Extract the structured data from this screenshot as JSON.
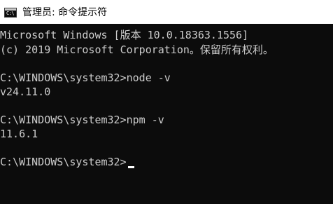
{
  "window": {
    "icon_text": "C:\\",
    "title": "管理员: 命令提示符"
  },
  "console": {
    "banner_line1": "Microsoft Windows [版本 10.0.18363.1556]",
    "banner_line2": "(c) 2019 Microsoft Corporation。保留所有权利。",
    "cmd1_line": "C:\\WINDOWS\\system32>node -v",
    "cmd1_output": "v24.11.0",
    "cmd2_line": "C:\\WINDOWS\\system32>npm -v",
    "cmd2_output": "11.6.1",
    "prompt": "C:\\WINDOWS\\system32>"
  },
  "colors": {
    "background": "#0c0c0c",
    "text": "#cccccc",
    "titlebar": "#ffffff",
    "cursor": "#ffffff"
  }
}
